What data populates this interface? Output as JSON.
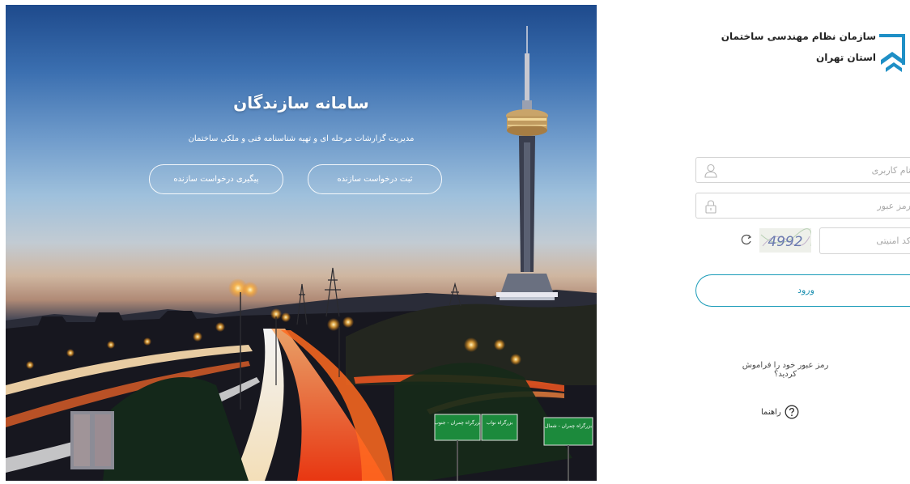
{
  "hero": {
    "title": "سامانه سازندگان",
    "subtitle": "مدیریت گزارشات مرحله ای و تهیه شناسنامه فنی و ملکی ساختمان",
    "register_button": "ثبت درخواست سازنده",
    "track_button": "پیگیری درخواست سازنده",
    "road_signs": [
      "بزرگراه چمران - جنوب",
      "بزرگراه نواب",
      "بزرگراه چمران - شمال"
    ]
  },
  "logo": {
    "line1": "سازمان نظام مهندسی ساختمان",
    "line2": "استان تهران"
  },
  "login": {
    "username_placeholder": "نام کاربری",
    "password_placeholder": "رمز عبور",
    "captcha_placeholder": "کد امنیتی",
    "captcha_text": "4992",
    "submit_label": "ورود",
    "forgot_link": "رمز عبور خود را فراموش کردید؟",
    "help_label": "راهنما"
  },
  "colors": {
    "accent": "#1a9bb8",
    "logo_blue": "#1e8fc6"
  }
}
